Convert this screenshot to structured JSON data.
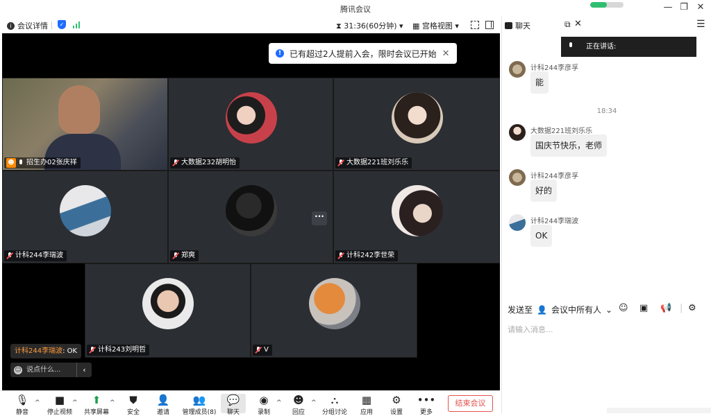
{
  "window": {
    "title": "腾讯会议",
    "minimize": "—",
    "restore": "❐",
    "close": "✕"
  },
  "toolbar": {
    "meeting_info": "会议详情",
    "timer": "31:36(60分钟)",
    "view_mode": "宫格视图"
  },
  "notice": {
    "text": "已有超过2人提前入会，限时会议已开始"
  },
  "tiles": [
    {
      "name": "招生办02张庆祥",
      "host": true,
      "mic": "on"
    },
    {
      "name": "大数据232胡明怡",
      "mic": "off"
    },
    {
      "name": "大数据221班刘乐乐",
      "mic": "off"
    },
    {
      "name": "计科244李瑞波",
      "mic": "off"
    },
    {
      "name": "郑爽",
      "mic": "off"
    },
    {
      "name": "计科242李世荣",
      "mic": "off"
    },
    {
      "name": "计科243刘明哲",
      "mic": "off"
    },
    {
      "name": "V",
      "mic": "off"
    }
  ],
  "overlay_chat": {
    "sender": "计科244李瑞波",
    "message": "OK",
    "input_placeholder": "说点什么..."
  },
  "bottom_bar": {
    "mute": "静音",
    "stop_video": "停止视频",
    "share_screen": "共享屏幕",
    "security": "安全",
    "invite": "邀请",
    "manage_members": "管理成员(8)",
    "chat": "聊天",
    "record": "录制",
    "reactions": "回应",
    "breakout": "分组讨论",
    "apps": "应用",
    "settings": "设置",
    "more": "更多",
    "end_meeting": "结束会议"
  },
  "chat_panel": {
    "title": "聊天",
    "speaking": "正在讲话:",
    "time_separator": "18:34",
    "messages": [
      {
        "sender": "计科244李彦孚",
        "text": "能"
      },
      {
        "sender": "大数据221班刘乐乐",
        "text": "国庆节快乐，老师"
      },
      {
        "sender": "计科244李彦孚",
        "text": "好的"
      },
      {
        "sender": "计科244李瑞波",
        "text": "OK"
      }
    ],
    "send_to_label": "发送至",
    "send_to_target": "会议中所有人",
    "input_placeholder": "请输入消息..."
  },
  "colors": {
    "accent": "#1e6cff",
    "end_meeting": "#e2504c",
    "host_badge": "#ff8a00",
    "overlay_sender": "#ff9a3c"
  }
}
